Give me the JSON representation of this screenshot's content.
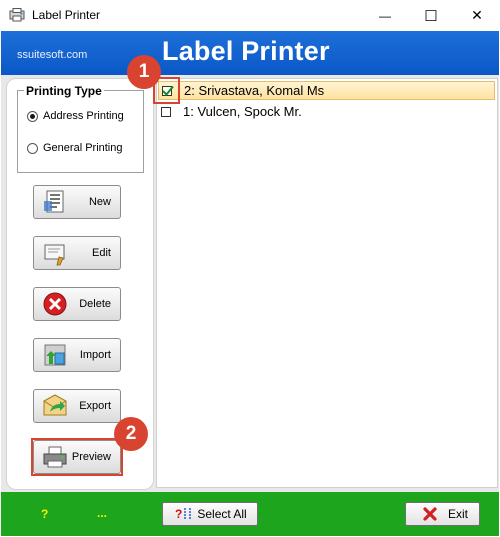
{
  "window": {
    "title": "Label Printer",
    "controls": {
      "minimize": "—",
      "maximize": "☐",
      "close": "✕"
    }
  },
  "header": {
    "brand": "ssuitesoft.com",
    "app_title": "Label Printer",
    "color": "#0a63d4"
  },
  "printing_type": {
    "title": "Printing Type",
    "options": [
      {
        "label": "Address Printing",
        "selected": true
      },
      {
        "label": "General Printing",
        "selected": false
      }
    ]
  },
  "sidebar_buttons": {
    "new": "New",
    "edit": "Edit",
    "delete": "Delete",
    "import": "Import",
    "export": "Export",
    "preview": "Preview"
  },
  "list": {
    "items": [
      {
        "text": "2:  Srivastava, Komal Ms",
        "checked": true,
        "selected": true
      },
      {
        "text": "1:  Vulcen, Spock Mr.",
        "checked": false,
        "selected": false
      }
    ]
  },
  "callouts": {
    "one": "1",
    "two": "2",
    "color": "#d94430"
  },
  "footer": {
    "help": "?",
    "dots": "...",
    "select_all": "Select All",
    "select_all_icon_text": "?",
    "exit": "Exit",
    "color": "#1ea51e"
  }
}
